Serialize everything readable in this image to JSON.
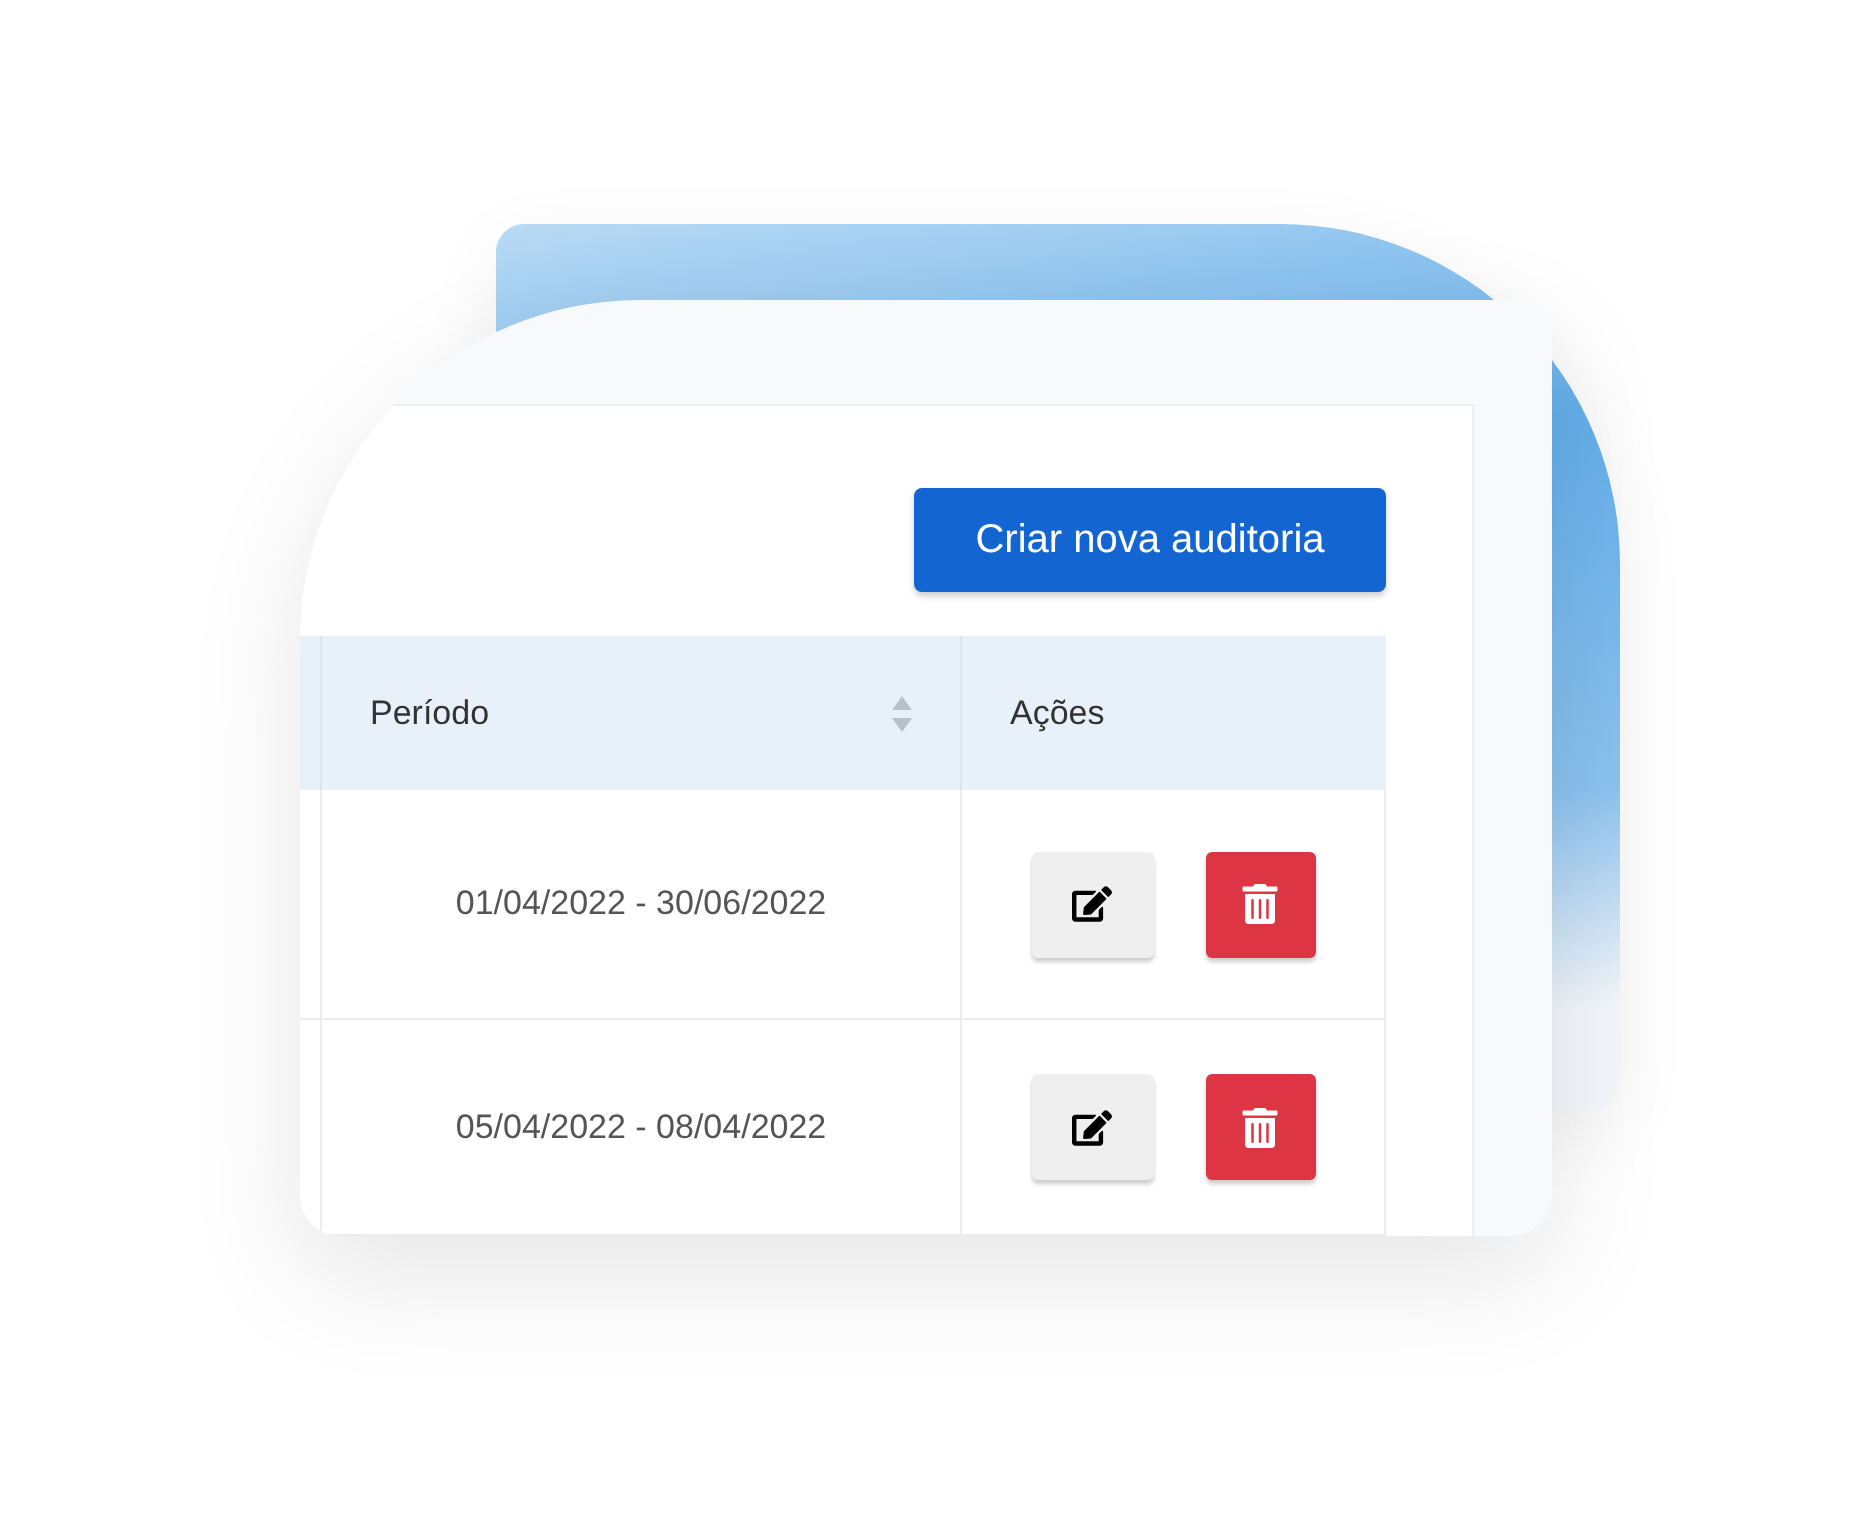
{
  "toolbar": {
    "create_button": "Criar nova auditoria"
  },
  "table": {
    "columns": [
      {
        "label": "Período",
        "sortable": true
      },
      {
        "label": "Ações",
        "sortable": false
      }
    ],
    "rows": [
      {
        "period": "01/04/2022 - 30/06/2022"
      },
      {
        "period": "05/04/2022 - 08/04/2022"
      }
    ]
  }
}
